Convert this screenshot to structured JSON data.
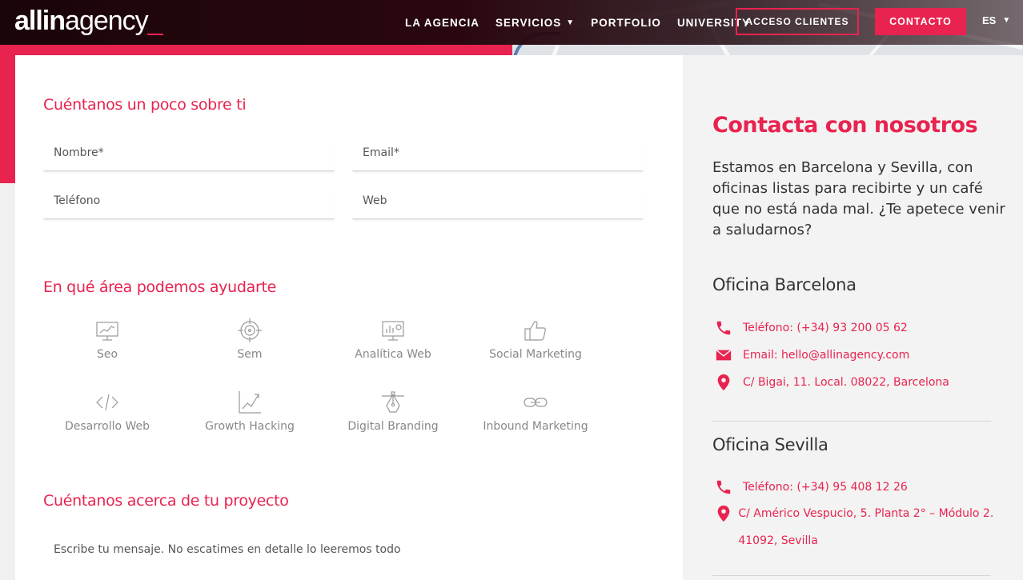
{
  "header": {
    "logo_bold": "allin",
    "logo_light": "agency",
    "logo_cursor": "_",
    "nav": [
      {
        "label": "LA AGENCIA"
      },
      {
        "label": "SERVICIOS",
        "dropdown": true
      },
      {
        "label": "PORTFOLIO"
      },
      {
        "label": "UNIVERSITY"
      }
    ],
    "clients_button": "ACCESO CLIENTES",
    "contact_button": "CONTACTO",
    "language": "ES"
  },
  "form": {
    "section1_title": "Cuéntanos un poco sobre ti",
    "name_placeholder": "Nombre*",
    "email_placeholder": "Email*",
    "phone_placeholder": "Teléfono",
    "web_placeholder": "Web",
    "section2_title": "En qué área podemos ayudarte",
    "areas": [
      {
        "label": "Seo",
        "icon": "seo-chart-icon"
      },
      {
        "label": "Sem",
        "icon": "target-icon"
      },
      {
        "label": "Analítica Web",
        "icon": "analytics-monitor-icon"
      },
      {
        "label": "Social Marketing",
        "icon": "thumbs-up-icon"
      },
      {
        "label": "Desarrollo Web",
        "icon": "code-icon"
      },
      {
        "label": "Growth Hacking",
        "icon": "growth-chart-icon"
      },
      {
        "label": "Digital Branding",
        "icon": "pen-tool-icon"
      },
      {
        "label": "Inbound Marketing",
        "icon": "link-icon"
      }
    ],
    "section3_title": "Cuéntanos acerca de tu proyecto",
    "message_placeholder": "Escribe tu mensaje. No escatimes en detalle lo leeremos todo"
  },
  "contact": {
    "title": "Contacta con nosotros",
    "description": "Estamos en Barcelona y Sevilla, con oficinas listas para recibirte y un café que no está nada mal.  ¿Te apetece venir a saludarnos?",
    "barcelona": {
      "title": "Oficina Barcelona",
      "phone": "Teléfono: (+34) 93 200 05 62",
      "email": "Email: hello@allinagency.com",
      "address": "C/ Bigai, 11. Local. 08022, Barcelona"
    },
    "sevilla": {
      "title": "Oficina Sevilla",
      "phone": "Teléfono: (+34) 95 408 12 26",
      "address": "C/ Américo Vespucio, 5. Planta 2° – Módulo 2. 41092, Sevilla"
    }
  },
  "colors": {
    "accent": "#e8234f",
    "header_bg": "#1a0508",
    "panel_bg": "#f3f3f3"
  }
}
